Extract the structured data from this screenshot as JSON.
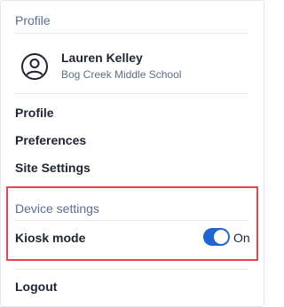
{
  "profile_section": {
    "title": "Profile",
    "user": {
      "name": "Lauren Kelley",
      "school": "Bog Creek Middle School",
      "avatar_icon": "user-circle-icon"
    }
  },
  "menu": {
    "profile": "Profile",
    "preferences": "Preferences",
    "site_settings": "Site Settings"
  },
  "device_settings": {
    "title": "Device settings",
    "kiosk_label": "Kiosk mode",
    "kiosk_state": "On",
    "kiosk_enabled": true,
    "toggle_color": "#1f66d1"
  },
  "logout": "Logout",
  "highlight_color": "#e4444b"
}
